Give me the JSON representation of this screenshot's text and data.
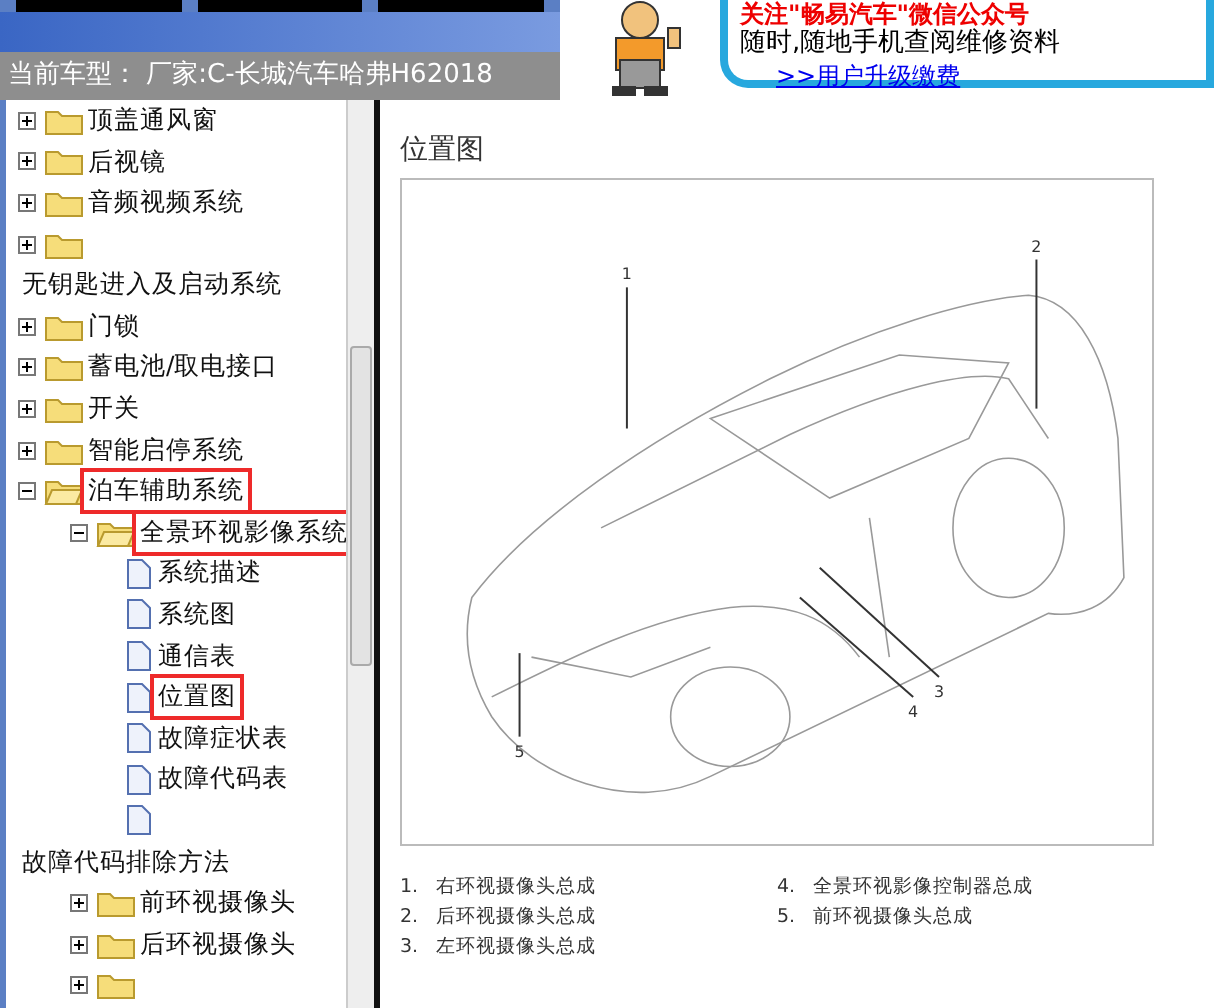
{
  "header": {
    "current_model": "当前车型： 厂家:C-长城汽车哈弗H62018"
  },
  "banner": {
    "headline": "关注\"畅易汽车\"微信公众号",
    "tagline": "随时,随地手机查阅维修资料",
    "link": ">>用户升级缴费"
  },
  "tree": [
    {
      "kind": "folder",
      "label": "顶盖通风窗",
      "expanded": false
    },
    {
      "kind": "folder",
      "label": "后视镜",
      "expanded": false
    },
    {
      "kind": "folder",
      "label": "音频视频系统",
      "expanded": false
    },
    {
      "kind": "folder",
      "expanded": false
    },
    {
      "kind": "heading",
      "label": "无钥匙进入及启动系统"
    },
    {
      "kind": "folder",
      "label": "门锁",
      "expanded": false
    },
    {
      "kind": "folder",
      "label": "蓄电池/取电接口",
      "expanded": false
    },
    {
      "kind": "folder",
      "label": "开关",
      "expanded": false
    },
    {
      "kind": "folder",
      "label": "智能启停系统",
      "expanded": false
    },
    {
      "kind": "folder",
      "label": "泊车辅助系统",
      "expanded": true,
      "highlighted": true,
      "children": [
        {
          "kind": "folder",
          "label": "全景环视影像系统",
          "expanded": true,
          "highlighted": true,
          "children": [
            {
              "kind": "doc",
              "label": "系统描述"
            },
            {
              "kind": "doc",
              "label": "系统图"
            },
            {
              "kind": "doc",
              "label": "通信表"
            },
            {
              "kind": "doc",
              "label": "位置图",
              "highlighted": true
            },
            {
              "kind": "doc",
              "label": "故障症状表"
            },
            {
              "kind": "doc",
              "label": "故障代码表"
            },
            {
              "kind": "doc"
            }
          ]
        }
      ]
    },
    {
      "kind": "heading",
      "label": "故障代码排除方法",
      "children": [
        {
          "kind": "folder",
          "label": "前环视摄像头",
          "expanded": false
        },
        {
          "kind": "folder",
          "label": "后环视摄像头",
          "expanded": false
        },
        {
          "kind": "folder",
          "expanded": false
        }
      ]
    }
  ],
  "document": {
    "title": "位置图",
    "callouts": [
      "1",
      "2",
      "3",
      "4",
      "5"
    ],
    "legend": [
      {
        "number": "1.",
        "text": "右环视摄像头总成"
      },
      {
        "number": "2.",
        "text": "后环视摄像头总成"
      },
      {
        "number": "3.",
        "text": "左环视摄像头总成"
      },
      {
        "number": "4.",
        "text": "全景环视影像控制器总成"
      },
      {
        "number": "5.",
        "text": "前环视摄像头总成"
      }
    ]
  }
}
